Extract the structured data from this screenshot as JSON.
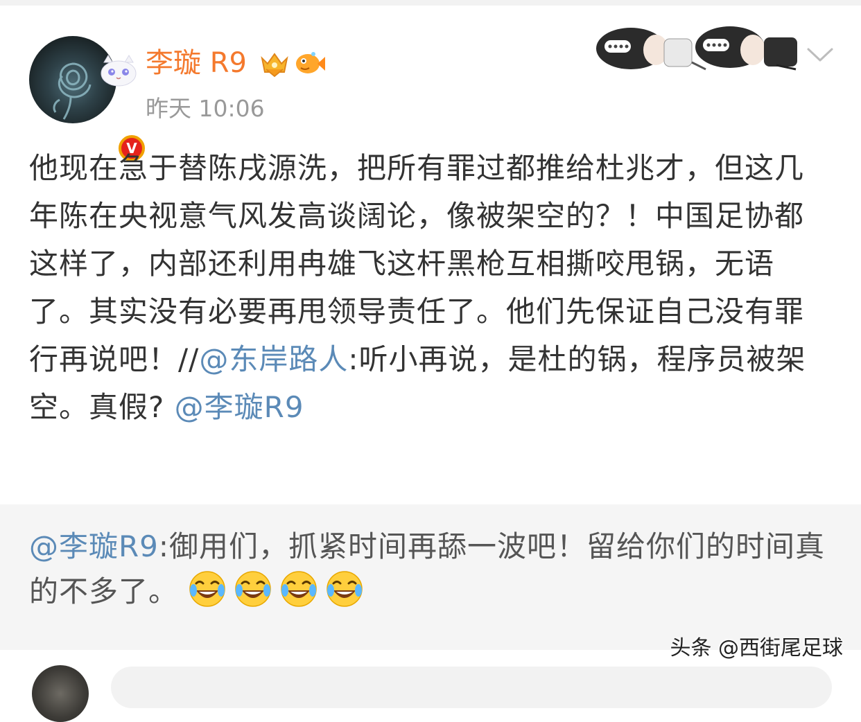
{
  "post": {
    "author": {
      "name": "李璇 R9",
      "badges": [
        "vip-crown-icon",
        "fish-badge-icon"
      ],
      "verified_mark": "V"
    },
    "time": "昨天 10:06",
    "text": {
      "main": "他现在急于替陈戌源洗，把所有罪过都推给杜兆才，但这几年陈在央视意气风发高谈阔论，像被架空的？！中国足协都这样了，内部还利用冉雄飞这杆黑枪互相撕咬甩锅，无语了。其实没有必要再甩领导责任了。他们先保证自己没有罪行再说吧！//",
      "repost_mention": "@东岸路人",
      "repost_text": ":听小再说，是杜的锅，程序员被架空。真假? ",
      "repost_mention_2": "@李璇R9"
    }
  },
  "quote": {
    "mention": "@李璇R9",
    "text": ":御用们，抓紧时间再舔一波吧！留给你们的时间真的不多了。",
    "emojis": [
      "laugh-cry-emoji",
      "laugh-cry-emoji",
      "laugh-cry-emoji",
      "laugh-cry-emoji"
    ]
  },
  "watermark": "头条 @西街尾足球",
  "colors": {
    "username": "#f4792d",
    "mention": "#5b8ab7",
    "time": "#999999",
    "quote_bg": "#f5f5f5"
  }
}
